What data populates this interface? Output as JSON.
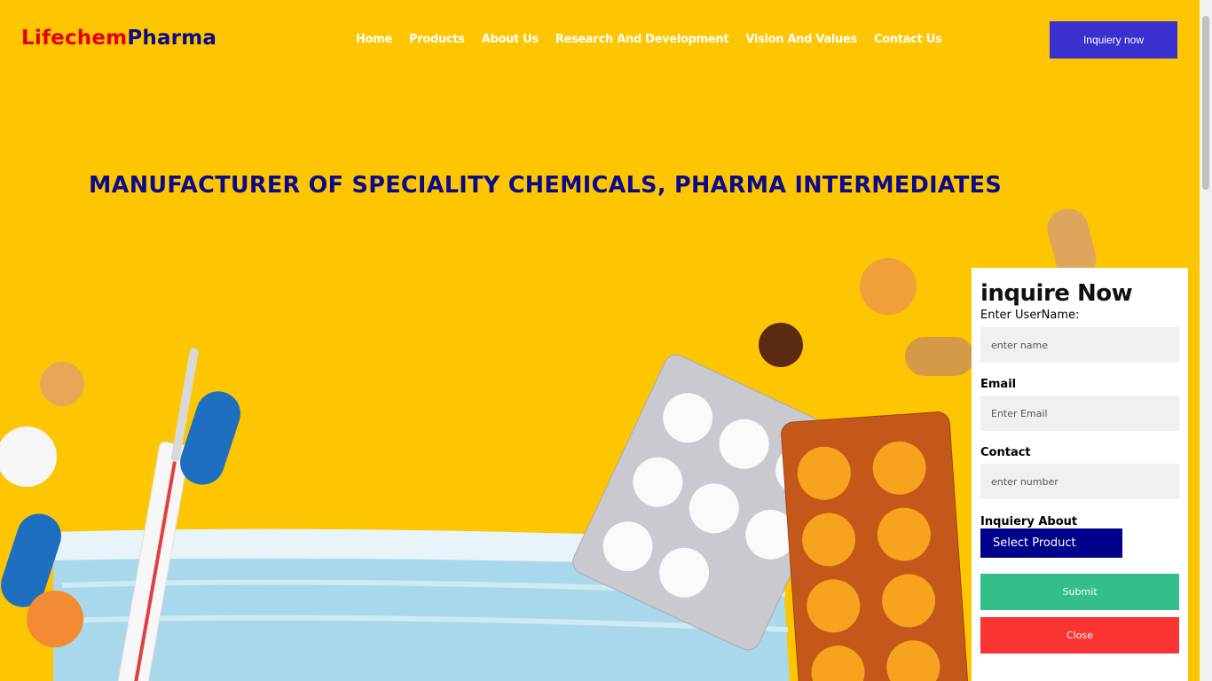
{
  "header": {
    "logo_part1": "Lifechem",
    "logo_part2": "Pharma",
    "nav": [
      "Home",
      "Products",
      "About Us",
      "Research And Development",
      "Vision And Values",
      "Contact Us"
    ],
    "cta": "Inquiery now"
  },
  "hero": {
    "headline": "MANUFACTURER OF SPECIALITY CHEMICALS, PHARMA INTERMEDIATES"
  },
  "form": {
    "title": "inquire Now",
    "username_label": "Enter UserName:",
    "username_placeholder": "enter name",
    "email_label": "Email",
    "email_placeholder": "Enter Email",
    "contact_label": "Contact",
    "contact_placeholder": "enter number",
    "inquiry_label": "Inquiery About",
    "select_value": "Select Product",
    "submit": "Submit",
    "close": "Close"
  },
  "colors": {
    "background": "#fec600",
    "brand_red": "#e3000f",
    "brand_navy": "#0d0a8a",
    "cta": "#3a30d0",
    "submit": "#33be8a",
    "close": "#fa3333"
  }
}
